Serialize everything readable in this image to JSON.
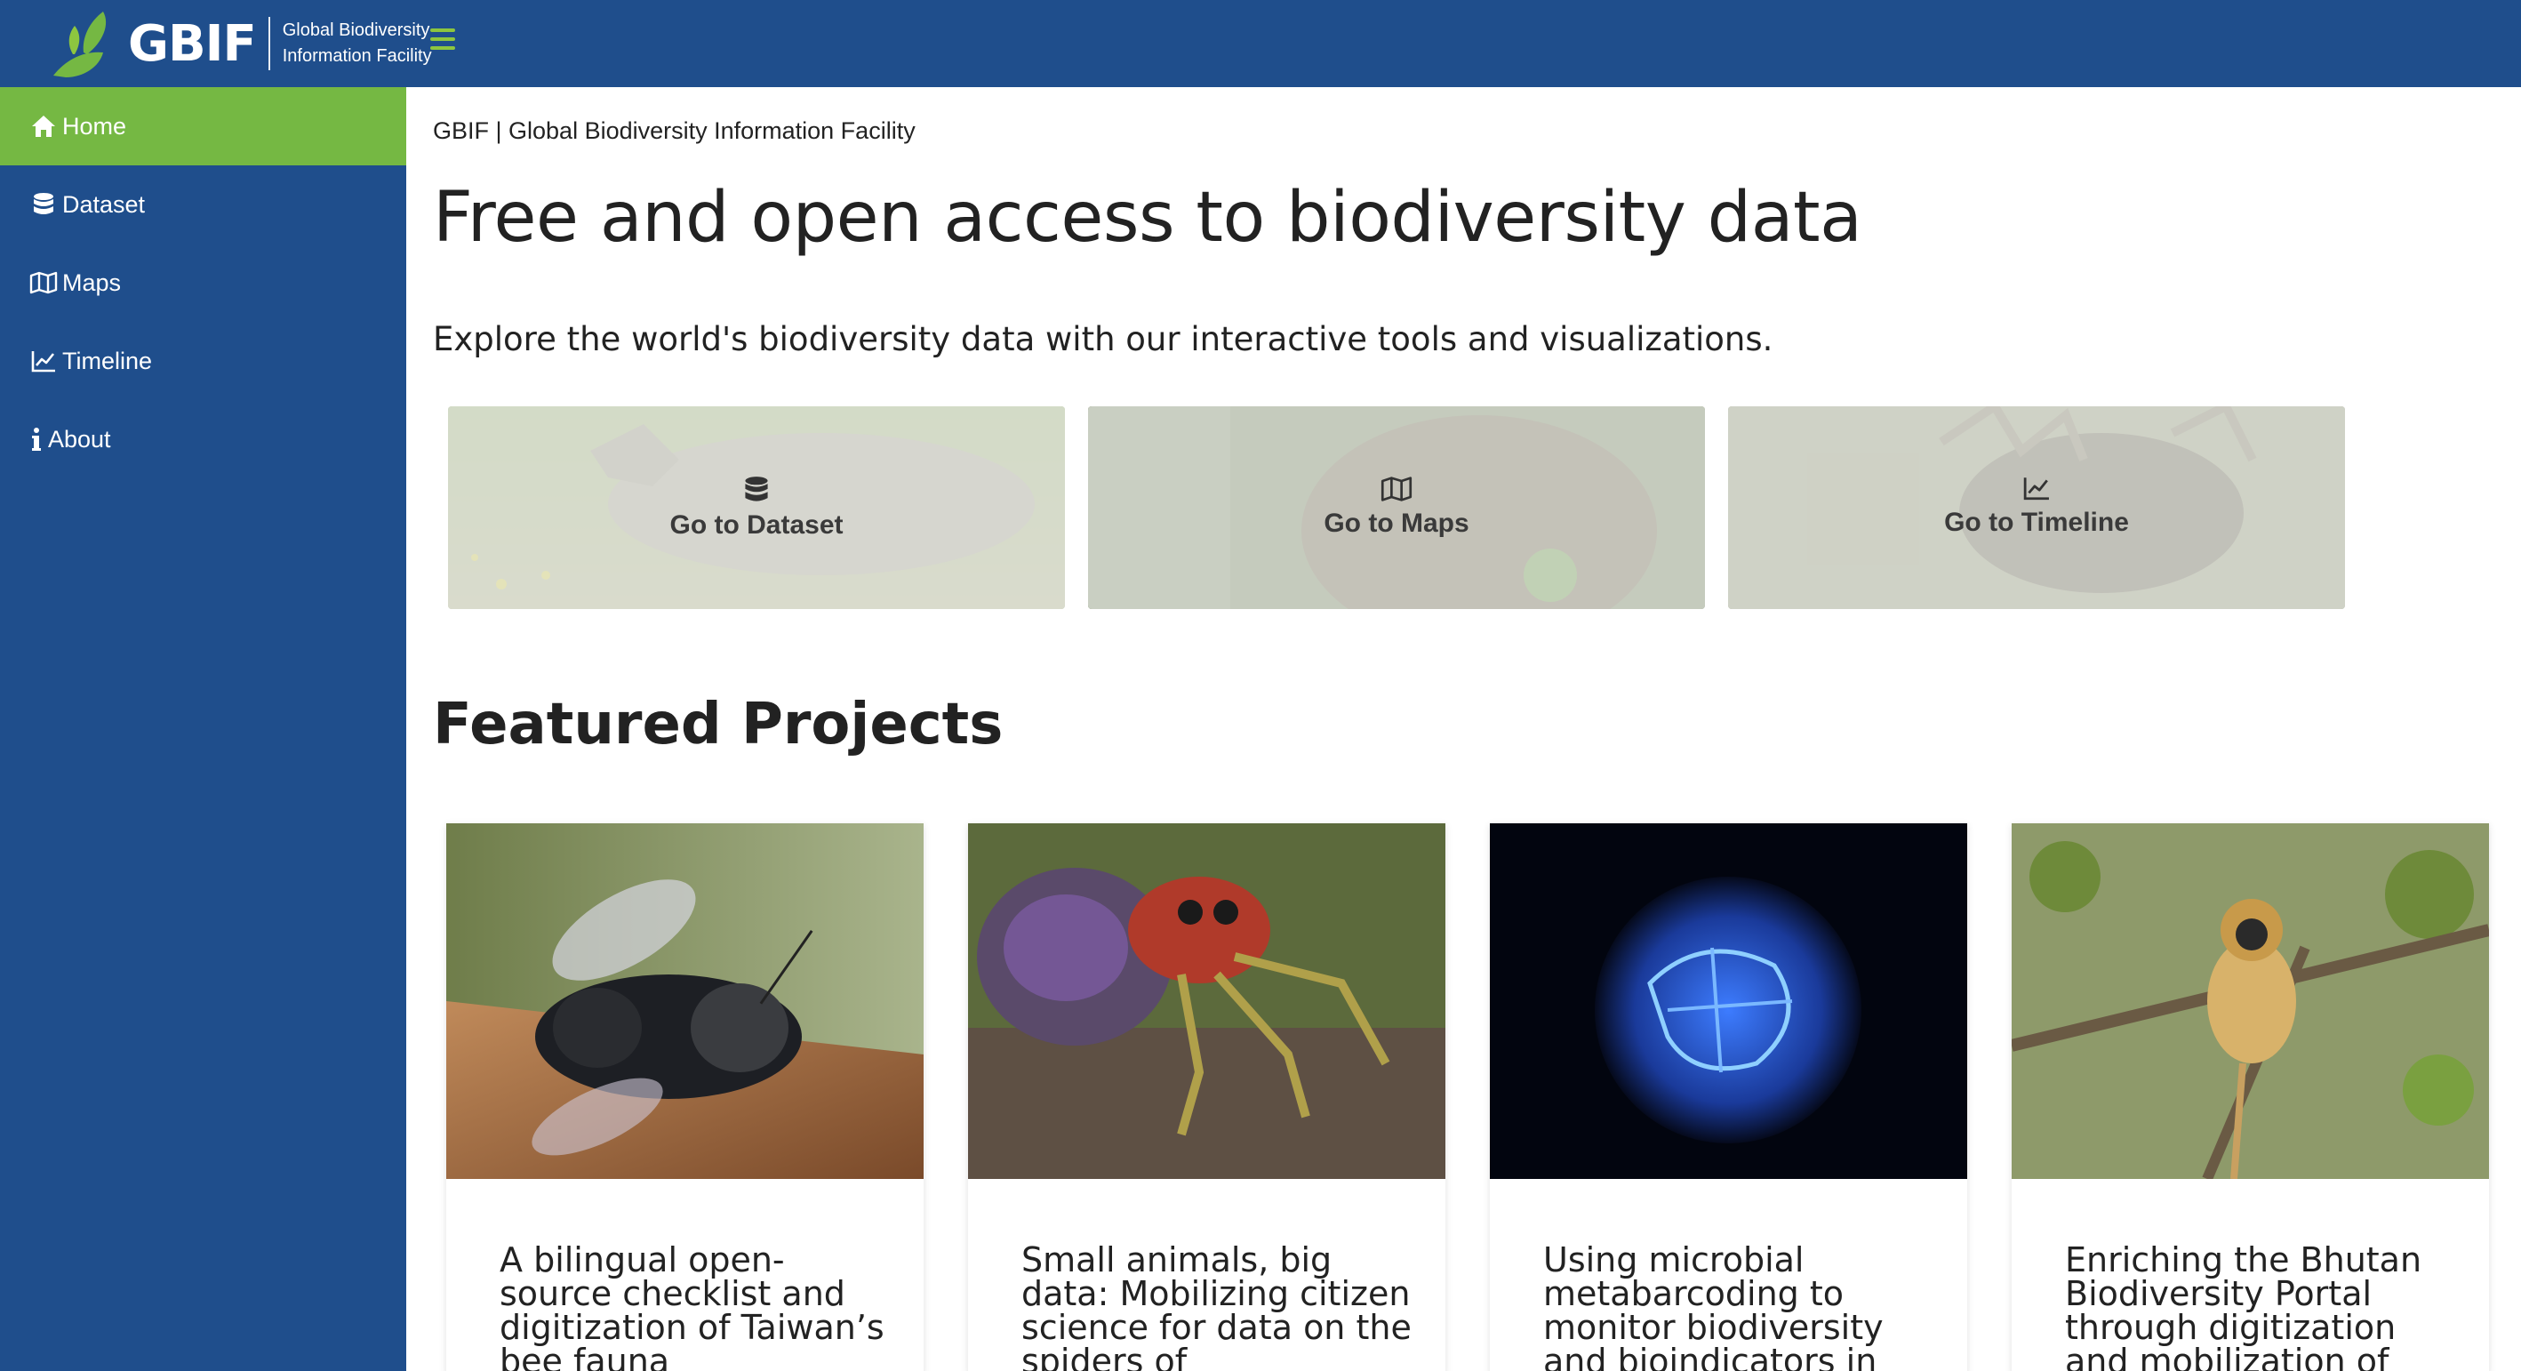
{
  "header": {
    "logo_word": "GBIF",
    "logo_sub_line1": "Global Biodiversity",
    "logo_sub_line2": "Information Facility",
    "menu_icon": "hamburger-icon"
  },
  "sidebar": {
    "items": [
      {
        "label": "Home",
        "icon": "home-icon",
        "active": true
      },
      {
        "label": "Dataset",
        "icon": "database-icon",
        "active": false
      },
      {
        "label": "Maps",
        "icon": "map-icon",
        "active": false
      },
      {
        "label": "Timeline",
        "icon": "chart-line-icon",
        "active": false
      },
      {
        "label": "About",
        "icon": "info-icon",
        "active": false
      }
    ]
  },
  "main": {
    "breadcrumb": "GBIF | Global Biodiversity Information Facility",
    "headline": "Free and open access to biodiversity data",
    "subtitle": "Explore the world's biodiversity data with our interactive tools and visualizations.",
    "nav_cards": [
      {
        "label": "Go to Dataset",
        "icon": "database-icon"
      },
      {
        "label": "Go to Maps",
        "icon": "map-icon"
      },
      {
        "label": "Go to Timeline",
        "icon": "chart-line-icon"
      }
    ],
    "featured_title": "Featured Projects",
    "projects": [
      {
        "title": "A bilingual open-source checklist and digitization of Taiwan’s bee fauna"
      },
      {
        "title": "Small animals, big data: Mobilizing citizen science for data on the spiders of"
      },
      {
        "title": "Using microbial metabarcoding to monitor biodiversity and bioindicators in"
      },
      {
        "title": "Enriching the Bhutan Biodiversity Portal through digitization and mobilization of"
      }
    ]
  },
  "colors": {
    "brand_blue": "#1f4e8c",
    "brand_green": "#75b843",
    "hamburger_green": "#8dc63f"
  }
}
